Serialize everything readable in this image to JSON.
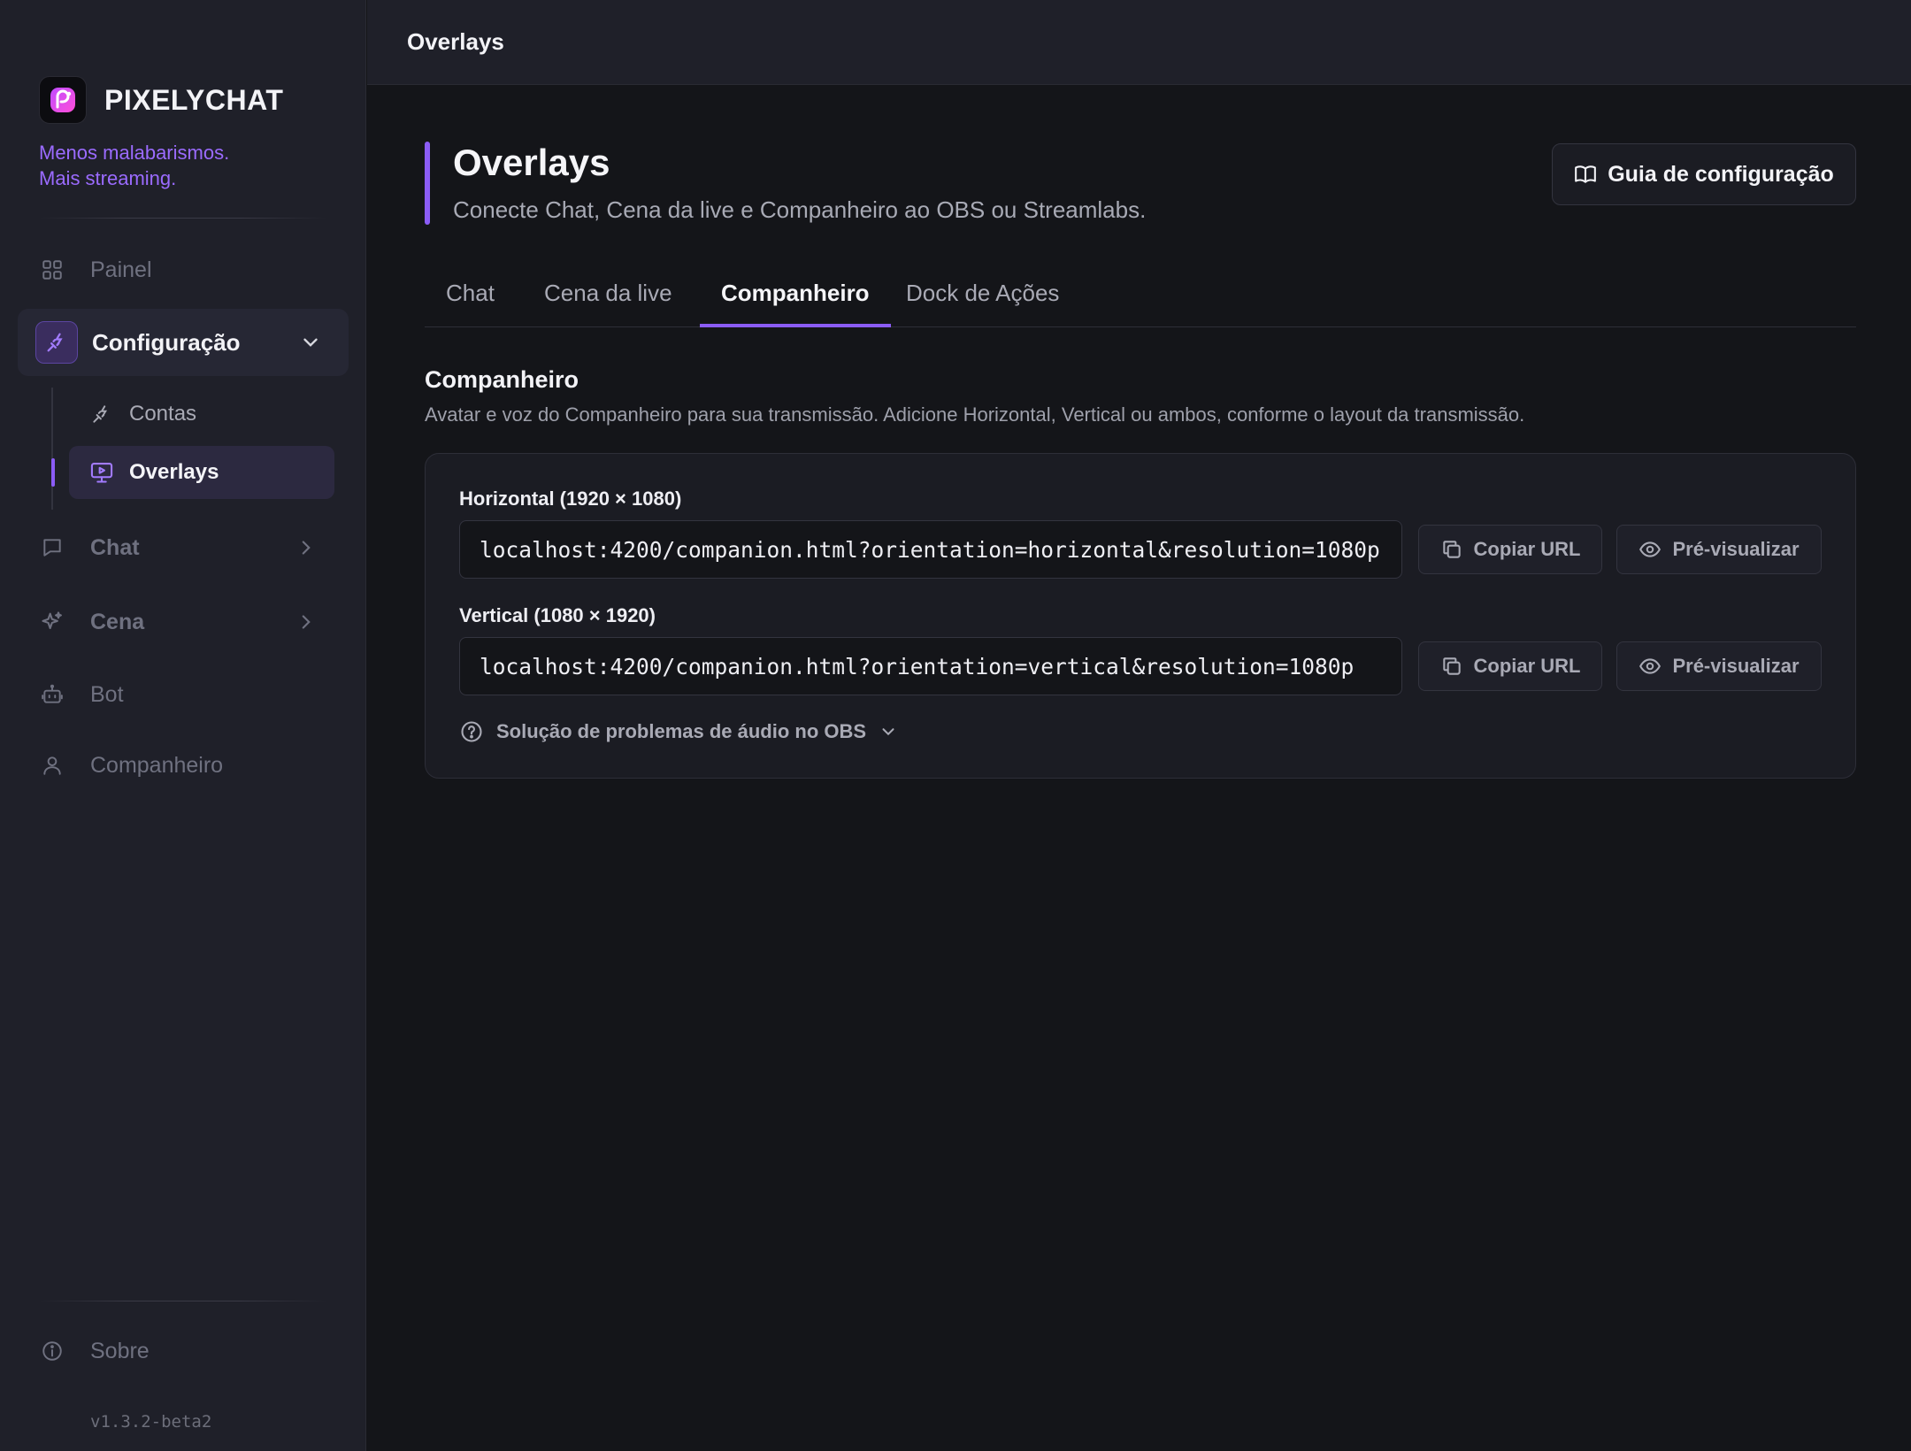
{
  "brand": {
    "name": "PIXELYCHAT",
    "tagline_line1": "Menos malabarismos.",
    "tagline_line2": "Mais streaming."
  },
  "sidebar": {
    "items": [
      {
        "label": "Painel",
        "icon": "grid-icon"
      },
      {
        "label": "Configuração",
        "icon": "plug-icon",
        "expanded": true
      },
      {
        "label": "Chat",
        "icon": "chat-bubble-icon"
      },
      {
        "label": "Cena",
        "icon": "sparkles-icon"
      },
      {
        "label": "Bot",
        "icon": "robot-icon"
      },
      {
        "label": "Companheiro",
        "icon": "user-icon"
      }
    ],
    "subitems": [
      {
        "label": "Contas",
        "icon": "plug-icon"
      },
      {
        "label": "Overlays",
        "icon": "monitor-play-icon",
        "active": true
      }
    ],
    "about": "Sobre",
    "version": "v1.3.2-beta2"
  },
  "topbar": {
    "title": "Overlays"
  },
  "page": {
    "title": "Overlays",
    "subtitle": "Conecte Chat, Cena da live e Companheiro ao OBS ou Streamlabs.",
    "guide_button": "Guia de configuração"
  },
  "tabs": [
    {
      "label": "Chat"
    },
    {
      "label": "Cena da live"
    },
    {
      "label": "Companheiro",
      "active": true
    },
    {
      "label": "Dock de Ações"
    }
  ],
  "section": {
    "title": "Companheiro",
    "description": "Avatar e voz do Companheiro para sua transmissão. Adicione Horizontal, Vertical ou ambos, conforme o layout da transmissão.",
    "horizontal": {
      "label": "Horizontal (1920 × 1080)",
      "url": "localhost:4200/companion.html?orientation=horizontal&resolution=1080p"
    },
    "vertical": {
      "label": "Vertical (1080 × 1920)",
      "url": "localhost:4200/companion.html?orientation=vertical&resolution=1080p"
    },
    "copy_label": "Copiar URL",
    "preview_label": "Pré-visualizar",
    "help_label": "Solução de problemas de áudio no OBS"
  },
  "colors": {
    "accent": "#8b5cf6",
    "tagline": "#9b6bff",
    "background": "#141519",
    "sidebar": "#1f2029"
  }
}
